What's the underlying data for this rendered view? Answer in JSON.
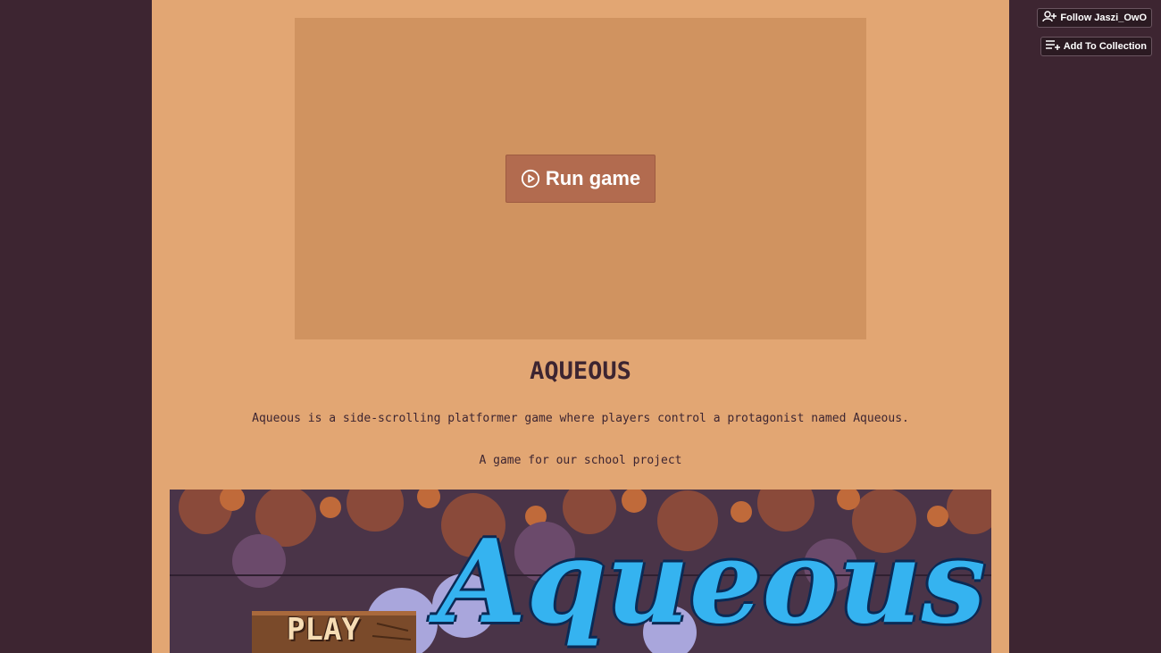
{
  "header": {
    "follow_label": "Follow Jaszi_OwO",
    "collection_label": "Add To Collection"
  },
  "game": {
    "run_label": "Run game"
  },
  "content": {
    "title": "AQUEOUS",
    "description": "Aqueous is a side-scrolling platformer game where players control a protagonist named Aqueous.",
    "note": "A game for our school project"
  },
  "banner": {
    "play_text": "PLAY",
    "logo_text": "Aqueous"
  },
  "colors": {
    "page_bg": "#3d2531",
    "column_bg": "#e2a673",
    "frame_bg": "#d09360",
    "button_bg": "#b26b4f",
    "text": "#3d2531",
    "logo_blue": "#35b3f0"
  },
  "icons": {
    "follow": "user-plus-icon",
    "collection": "playlist-add-icon",
    "run": "play-circle-icon"
  }
}
